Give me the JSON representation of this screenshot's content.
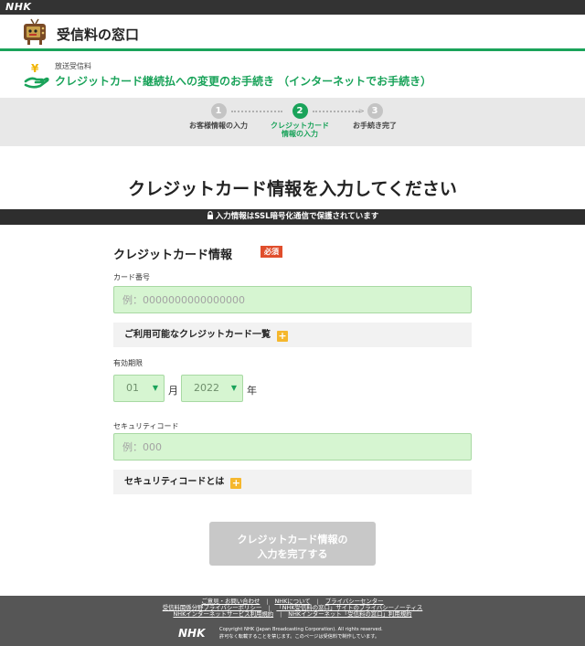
{
  "header": {
    "brand": "NHK",
    "site_title": "受信料の窓口"
  },
  "service": {
    "small_label": "放送受信料",
    "title": "クレジットカード継続払への変更のお手続き （インターネットでお手続き）"
  },
  "steps": [
    {
      "num": "1",
      "label_line1": "お客様情報の入力",
      "label_line2": "",
      "active": false
    },
    {
      "num": "2",
      "label_line1": "クレジットカード",
      "label_line2": "情報の入力",
      "active": true
    },
    {
      "num": "3",
      "label_line1": "お手続き完了",
      "label_line2": "",
      "active": false
    }
  ],
  "main": {
    "heading": "クレジットカード情報を入力してください",
    "ssl_notice": "入力情報はSSL暗号化通信で保護されています",
    "section_title": "クレジットカード情報",
    "required_badge": "必須",
    "card_number_label": "カード番号",
    "card_number_placeholder": "例：0000000000000000",
    "card_list_label": "ご利用可能なクレジットカード一覧",
    "expiry_label": "有効期限",
    "expiry_month": "01",
    "month_unit": "月",
    "expiry_year": "2022",
    "year_unit": "年",
    "security_label": "セキュリティコード",
    "security_placeholder": "例：000",
    "security_help_label": "セキュリティコードとは",
    "submit_line1": "クレジットカード情報の",
    "submit_line2": "入力を完了する"
  },
  "footer": {
    "links_row1": [
      "ご意見・お問い合わせ",
      "NHKについて",
      "プライバシーセンター"
    ],
    "links_row2": [
      "受信料関係分野プライバシーポリシー",
      "「NHK受信料の窓口」サイトのプライバシーノーティス"
    ],
    "links_row3": [
      "NHKインターネットサービス利用規約",
      "NHKインターネット「受信料の窓口」利用規約"
    ],
    "logo": "NHK",
    "copyright_line1": "Copyright NHK (Japan Broadcasting Corporation). All rights reserved.",
    "copyright_line2": "許可なく転載することを禁じます。このページは受信料で制作しています。"
  },
  "colors": {
    "brand_green": "#1aa35a",
    "input_green": "#d6f5d1",
    "required_red": "#e04e2c",
    "plus_yellow": "#f5b72d",
    "disabled_button": "#c8c8c8"
  },
  "icons": {
    "site": "tv-mascot-icon",
    "service": "yen-hand-icon",
    "ssl": "lock-icon",
    "expand": "plus-icon",
    "select": "caret-down-icon"
  }
}
